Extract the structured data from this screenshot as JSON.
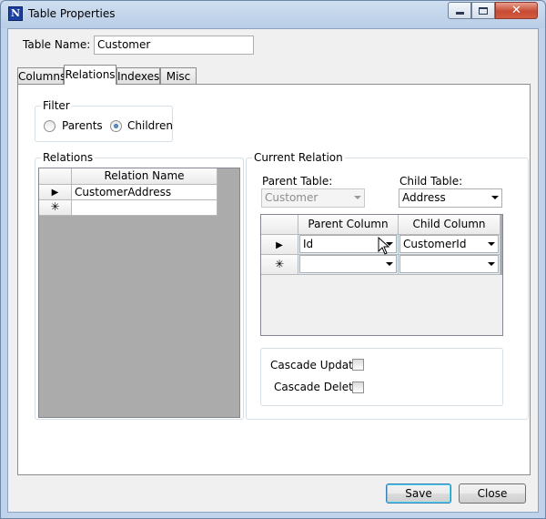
{
  "window": {
    "title": "Table Properties",
    "icon_letter": "N"
  },
  "table_name": {
    "label": "Table Name:",
    "value": "Customer"
  },
  "tabs": [
    {
      "label": "Columns",
      "active": false
    },
    {
      "label": "Relations",
      "active": true
    },
    {
      "label": "Indexes",
      "active": false
    },
    {
      "label": "Misc",
      "active": false
    }
  ],
  "filter": {
    "title": "Filter",
    "options": [
      {
        "label": "Parents",
        "selected": false
      },
      {
        "label": "Children",
        "selected": true
      }
    ]
  },
  "relations": {
    "title": "Relations",
    "column_header": "Relation Name",
    "rows": [
      "CustomerAddress"
    ]
  },
  "current_relation": {
    "title": "Current Relation",
    "parent_table_label": "Parent Table:",
    "parent_table_value": "Customer",
    "child_table_label": "Child Table:",
    "child_table_value": "Address",
    "columns_grid": {
      "headers": [
        "Parent Column",
        "Child Column"
      ],
      "rows": [
        {
          "parent": "Id",
          "child": "CustomerId"
        }
      ]
    },
    "cascade_update_label": "Cascade Update:",
    "cascade_delete_label": "Cascade Delete:",
    "cascade_update_checked": false,
    "cascade_delete_checked": false
  },
  "buttons": {
    "save": "Save",
    "close": "Close"
  },
  "glyphs": {
    "current_row": "▶",
    "new_row": "✳",
    "close_x": "✕"
  }
}
